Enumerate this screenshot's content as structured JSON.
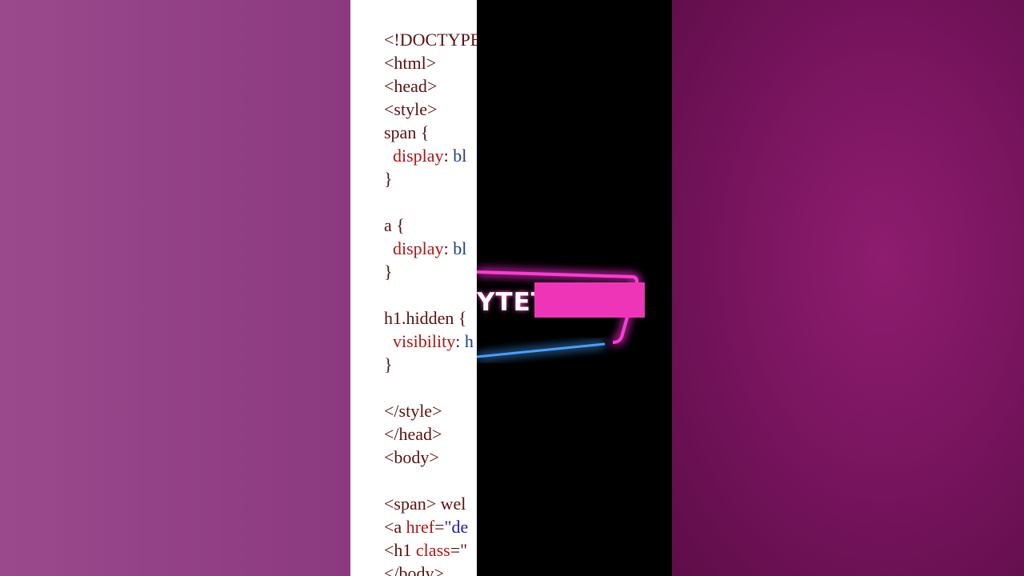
{
  "code_lines": [
    {
      "parts": [
        {
          "t": "<!DOCTYPE",
          "c": "tag"
        }
      ]
    },
    {
      "parts": [
        {
          "t": "<html>",
          "c": "tag"
        }
      ]
    },
    {
      "parts": [
        {
          "t": "<head>",
          "c": "tag"
        }
      ]
    },
    {
      "parts": [
        {
          "t": "<style>",
          "c": "tag"
        }
      ]
    },
    {
      "parts": [
        {
          "t": "span {",
          "c": "tag"
        }
      ]
    },
    {
      "parts": [
        {
          "t": "  display",
          "c": "prop"
        },
        {
          "t": ": ",
          "c": "tag"
        },
        {
          "t": "bl",
          "c": "val"
        }
      ]
    },
    {
      "parts": [
        {
          "t": "}",
          "c": "tag"
        }
      ]
    },
    {
      "parts": [
        {
          "t": "",
          "c": "tag"
        }
      ]
    },
    {
      "parts": [
        {
          "t": "a {",
          "c": "tag"
        }
      ]
    },
    {
      "parts": [
        {
          "t": "  display",
          "c": "prop"
        },
        {
          "t": ": ",
          "c": "tag"
        },
        {
          "t": "bl",
          "c": "val"
        }
      ]
    },
    {
      "parts": [
        {
          "t": "}",
          "c": "tag"
        }
      ]
    },
    {
      "parts": [
        {
          "t": "",
          "c": "tag"
        }
      ]
    },
    {
      "parts": [
        {
          "t": "h1.hidden {",
          "c": "tag"
        }
      ]
    },
    {
      "parts": [
        {
          "t": "  visibility",
          "c": "prop"
        },
        {
          "t": ": ",
          "c": "tag"
        },
        {
          "t": "h",
          "c": "val"
        }
      ]
    },
    {
      "parts": [
        {
          "t": "}",
          "c": "tag"
        }
      ]
    },
    {
      "parts": [
        {
          "t": "",
          "c": "tag"
        }
      ]
    },
    {
      "parts": [
        {
          "t": "</style>",
          "c": "tag"
        }
      ]
    },
    {
      "parts": [
        {
          "t": "</head>",
          "c": "tag"
        }
      ]
    },
    {
      "parts": [
        {
          "t": "<body>",
          "c": "tag"
        }
      ]
    },
    {
      "parts": [
        {
          "t": "",
          "c": "tag"
        }
      ]
    },
    {
      "parts": [
        {
          "t": "<span> wel",
          "c": "tag"
        }
      ]
    },
    {
      "parts": [
        {
          "t": "<a ",
          "c": "tag"
        },
        {
          "t": "href",
          "c": "prop"
        },
        {
          "t": "=",
          "c": "tag"
        },
        {
          "t": "\"de",
          "c": "str"
        }
      ]
    },
    {
      "parts": [
        {
          "t": "<h1 ",
          "c": "tag"
        },
        {
          "t": "class",
          "c": "prop"
        },
        {
          "t": "=\"",
          "c": "tag"
        }
      ]
    },
    {
      "parts": [
        {
          "t": "</body>",
          "c": "tag"
        }
      ]
    }
  ],
  "neon_logo": {
    "text": "YTET",
    "frame_color": "#ff3ad6",
    "frame_glow_color": "#c020ff",
    "underline_color": "#4aa0ff",
    "block_color": "#ee35b8"
  },
  "colors": {
    "background_left": "#923f86",
    "background_right": "#7a1560",
    "code_background": "#ffffff",
    "video_background": "#000000"
  }
}
